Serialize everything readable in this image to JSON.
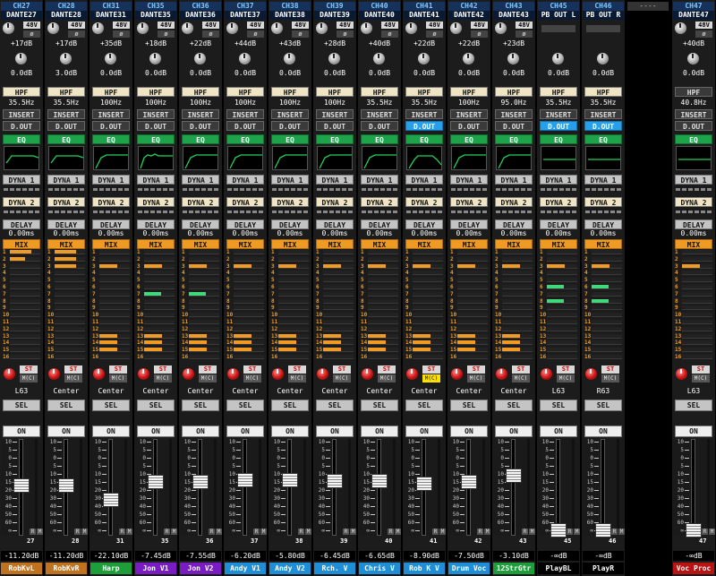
{
  "strips": [
    {
      "id": "CH27",
      "name": "DANTE27",
      "gain": "+17dB",
      "trim": "0.0dB",
      "hpf_freq": "35.5Hz",
      "hpf_style": "white",
      "dout_style": "dark",
      "dout_label": "D.OUT",
      "eq_shape": "lowshelf",
      "delay": "0.00ms",
      "pan": "L63",
      "mc_on": false,
      "fader_level": "-11.20dB",
      "ch_number": "27",
      "label": "RobKvL",
      "label_color": "#c0731e",
      "mix": [
        0.7,
        0.5,
        0,
        0,
        0,
        0,
        0,
        0,
        0,
        0,
        0,
        0,
        0,
        0,
        0,
        0
      ],
      "mix_green": [],
      "meter": [
        0.12
      ]
    },
    {
      "id": "CH28",
      "name": "DANTE28",
      "gain": "+17dB",
      "trim": "3.0dB",
      "hpf_freq": "35.5Hz",
      "hpf_style": "white",
      "dout_style": "dark",
      "dout_label": "D.OUT",
      "eq_shape": "lowshelf",
      "delay": "0.00ms",
      "pan": "Center",
      "mc_on": false,
      "fader_level": "-11.20dB",
      "ch_number": "28",
      "label": "RobKvR",
      "label_color": "#c0731e",
      "mix": [
        0.7,
        0.7,
        0.7,
        0,
        0,
        0,
        0,
        0,
        0,
        0,
        0,
        0,
        0,
        0,
        0,
        0
      ],
      "mix_green": [],
      "meter": [
        0.1
      ]
    },
    {
      "id": "CH31",
      "name": "DANTE31",
      "gain": "+35dB",
      "trim": "0.0dB",
      "hpf_freq": "100Hz",
      "hpf_style": "white",
      "dout_style": "dark",
      "dout_label": "D.OUT",
      "eq_shape": "hpf",
      "delay": "0.00ms",
      "pan": "Center",
      "mc_on": false,
      "fader_level": "-22.10dB",
      "ch_number": "31",
      "label": "Harp",
      "label_color": "#1e9e3a",
      "mix": [
        0,
        0,
        0.6,
        0,
        0,
        0,
        0,
        0,
        0,
        0,
        0,
        0,
        0.6,
        0.6,
        0.6,
        0
      ],
      "mix_green": [],
      "meter": [
        0.05
      ]
    },
    {
      "id": "CH35",
      "name": "DANTE35",
      "gain": "+18dB",
      "trim": "0.0dB",
      "hpf_freq": "100Hz",
      "hpf_style": "white",
      "dout_style": "dark",
      "dout_label": "D.OUT",
      "eq_shape": "peaky",
      "delay": "0.00ms",
      "pan": "Center",
      "mc_on": false,
      "fader_level": "-7.45dB",
      "ch_number": "35",
      "label": "Jon V1",
      "label_color": "#7a1cc4",
      "mix": [
        0,
        0,
        0.6,
        0,
        0,
        0,
        0,
        0,
        0,
        0,
        0,
        0,
        0.6,
        0.6,
        0.6,
        0
      ],
      "mix_green": [
        6
      ],
      "meter": [
        0.15
      ]
    },
    {
      "id": "CH36",
      "name": "DANTE36",
      "gain": "+22dB",
      "trim": "0.0dB",
      "hpf_freq": "100Hz",
      "hpf_style": "white",
      "dout_style": "dark",
      "dout_label": "D.OUT",
      "eq_shape": "hpf",
      "delay": "0.00ms",
      "pan": "Center",
      "mc_on": false,
      "fader_level": "-7.55dB",
      "ch_number": "36",
      "label": "Jon V2",
      "label_color": "#7a1cc4",
      "mix": [
        0,
        0,
        0.6,
        0,
        0,
        0,
        0,
        0,
        0,
        0,
        0,
        0,
        0.6,
        0.6,
        0.6,
        0
      ],
      "mix_green": [
        6
      ],
      "meter": [
        0.15
      ]
    },
    {
      "id": "CH37",
      "name": "DANTE37",
      "gain": "+44dB",
      "trim": "0.0dB",
      "hpf_freq": "100Hz",
      "hpf_style": "white",
      "dout_style": "dark",
      "dout_label": "D.OUT",
      "eq_shape": "hpf",
      "delay": "0.00ms",
      "pan": "Center",
      "mc_on": false,
      "fader_level": "-6.20dB",
      "ch_number": "37",
      "label": "Andy V1",
      "label_color": "#1e8fd6",
      "mix": [
        0,
        0,
        0.6,
        0,
        0,
        0,
        0,
        0,
        0,
        0,
        0,
        0,
        0.6,
        0.6,
        0.6,
        0
      ],
      "mix_green": [],
      "meter": [
        0.05
      ]
    },
    {
      "id": "CH38",
      "name": "DANTE38",
      "gain": "+43dB",
      "trim": "0.0dB",
      "hpf_freq": "100Hz",
      "hpf_style": "white",
      "dout_style": "dark",
      "dout_label": "D.OUT",
      "eq_shape": "hpf",
      "delay": "0.00ms",
      "pan": "Center",
      "mc_on": false,
      "fader_level": "-5.80dB",
      "ch_number": "38",
      "label": "Andy V2",
      "label_color": "#1e8fd6",
      "mix": [
        0,
        0,
        0.6,
        0,
        0,
        0,
        0,
        0,
        0,
        0,
        0,
        0,
        0.6,
        0.6,
        0.6,
        0
      ],
      "mix_green": [],
      "meter": [
        0.05
      ]
    },
    {
      "id": "CH39",
      "name": "DANTE39",
      "gain": "+28dB",
      "trim": "0.0dB",
      "hpf_freq": "100Hz",
      "hpf_style": "white",
      "dout_style": "dark",
      "dout_label": "D.OUT",
      "eq_shape": "hpf",
      "delay": "0.00ms",
      "pan": "Center",
      "mc_on": false,
      "fader_level": "-6.45dB",
      "ch_number": "39",
      "label": "Rch. V",
      "label_color": "#1e8fd6",
      "mix": [
        0,
        0,
        0.6,
        0,
        0,
        0,
        0,
        0,
        0,
        0,
        0,
        0,
        0.6,
        0.6,
        0.6,
        0
      ],
      "mix_green": [],
      "meter": [
        0.05
      ]
    },
    {
      "id": "CH40",
      "name": "DANTE40",
      "gain": "+40dB",
      "trim": "0.0dB",
      "hpf_freq": "35.5Hz",
      "hpf_style": "white",
      "dout_style": "dark",
      "dout_label": "D.OUT",
      "eq_shape": "hpf",
      "delay": "0.00ms",
      "pan": "Center",
      "mc_on": false,
      "fader_level": "-6.65dB",
      "ch_number": "40",
      "label": "Chris V",
      "label_color": "#1e8fd6",
      "mix": [
        0,
        0,
        0.6,
        0,
        0,
        0,
        0,
        0,
        0,
        0,
        0,
        0,
        0.6,
        0.6,
        0.6,
        0
      ],
      "mix_green": [],
      "meter": [
        0.05
      ]
    },
    {
      "id": "CH41",
      "name": "DANTE41",
      "gain": "+22dB",
      "trim": "0.0dB",
      "hpf_freq": "35.5Hz",
      "hpf_style": "white",
      "dout_style": "blue",
      "dout_label": "D.OUT",
      "eq_shape": "bandpass",
      "delay": "0.00ms",
      "pan": "Center",
      "mc_on": true,
      "fader_level": "-8.90dB",
      "ch_number": "41",
      "label": "Rob K V",
      "label_color": "#1e8fd6",
      "mix": [
        0,
        0,
        0.6,
        0,
        0,
        0,
        0,
        0,
        0,
        0,
        0,
        0,
        0.6,
        0.6,
        0.6,
        0
      ],
      "mix_green": [],
      "meter": [
        0.05
      ]
    },
    {
      "id": "CH42",
      "name": "DANTE42",
      "gain": "+22dB",
      "trim": "0.0dB",
      "hpf_freq": "100Hz",
      "hpf_style": "white",
      "dout_style": "dark",
      "dout_label": "D.OUT",
      "eq_shape": "hpf",
      "delay": "0.00ms",
      "pan": "Center",
      "mc_on": false,
      "fader_level": "-7.50dB",
      "ch_number": "42",
      "label": "Drum Voc",
      "label_color": "#1e8fd6",
      "mix": [
        0,
        0,
        0.6,
        0,
        0,
        0,
        0,
        0,
        0,
        0,
        0,
        0,
        0.6,
        0.6,
        0.6,
        0
      ],
      "mix_green": [],
      "meter": [
        0.05
      ]
    },
    {
      "id": "CH43",
      "name": "DANTE43",
      "gain": "+23dB",
      "trim": "0.0dB",
      "hpf_freq": "95.0Hz",
      "hpf_style": "white",
      "dout_style": "dark",
      "dout_label": "D.OUT",
      "eq_shape": "hpf",
      "delay": "0.00ms",
      "pan": "Center",
      "mc_on": false,
      "fader_level": "-3.10dB",
      "ch_number": "43",
      "label": "12StrGtr",
      "label_color": "#1e9e3a",
      "mix": [
        0,
        0,
        0.6,
        0,
        0,
        0,
        0,
        0,
        0,
        0,
        0,
        0,
        0.6,
        0.6,
        0.6,
        0
      ],
      "mix_green": [],
      "meter": [
        0.05
      ]
    },
    {
      "id": "CH45",
      "name": "PB OUT L",
      "gain": "",
      "trim": "0.0dB",
      "hpf_freq": "35.5Hz",
      "hpf_style": "white",
      "dout_style": "blue",
      "dout_label": "D.OUT",
      "eq_shape": "flat",
      "delay": "0.00ms",
      "pan": "L63",
      "mc_on": false,
      "fader_level": "-∞dB",
      "ch_number": "45",
      "label": "PlayBL",
      "label_color": "#000000",
      "mix": [
        0,
        0,
        0.6,
        0,
        0,
        0,
        0,
        0,
        0,
        0,
        0,
        0,
        0,
        0,
        0,
        0
      ],
      "mix_green": [
        5,
        7
      ],
      "meter": [
        0
      ]
    },
    {
      "id": "CH46",
      "name": "PB OUT R",
      "gain": "",
      "trim": "0.0dB",
      "hpf_freq": "35.5Hz",
      "hpf_style": "white",
      "dout_style": "blue",
      "dout_label": "D.OUT",
      "eq_shape": "flat",
      "delay": "0.00ms",
      "pan": "R63",
      "mc_on": false,
      "fader_level": "-∞dB",
      "ch_number": "46",
      "label": "PlayR",
      "label_color": "#000000",
      "mix": [
        0,
        0,
        0.6,
        0,
        0,
        0,
        0,
        0,
        0,
        0,
        0,
        0,
        0,
        0,
        0,
        0
      ],
      "mix_green": [
        5,
        7
      ],
      "meter": [
        0
      ]
    },
    {
      "blank": true,
      "header": "----"
    },
    {
      "id": "CH47",
      "name": "DANTE47",
      "gain": "+40dB",
      "trim": "0.0dB",
      "hpf_freq": "40.8Hz",
      "hpf_style": "dark",
      "dout_style": "dark",
      "dout_label": "D.OUT",
      "eq_shape": "flat",
      "delay": "0.00ms",
      "pan": "L63",
      "mc_on": false,
      "fader_level": "-∞dB",
      "ch_number": "47",
      "label": "Voc Proc",
      "label_color": "#b81414",
      "mix": [
        0,
        0,
        0.6,
        0,
        0,
        0,
        0,
        0,
        0,
        0,
        0,
        0,
        0,
        0,
        0,
        0
      ],
      "mix_green": [],
      "meter": [
        0
      ]
    }
  ],
  "labels": {
    "phantom": "48V",
    "phase": "ø",
    "hpf": "HPF",
    "insert": "INSERT",
    "eq": "EQ",
    "dyna1": "DYNA 1",
    "dyna2": "DYNA 2",
    "delay": "DELAY",
    "mix": "MIX",
    "st": "ST",
    "mc": "M(C)",
    "sel": "SEL",
    "on": "ON",
    "rec": "R",
    "mute": "M"
  },
  "mix_numbers": [
    "1",
    "2",
    "3",
    "4",
    "5",
    "6",
    "7",
    "8",
    "9",
    "10",
    "11",
    "12",
    "13",
    "14",
    "15",
    "16"
  ],
  "fader_scale": [
    "10",
    "5",
    "0",
    "5",
    "10",
    "15",
    "20",
    "30",
    "40",
    "50",
    "60",
    "∞"
  ]
}
